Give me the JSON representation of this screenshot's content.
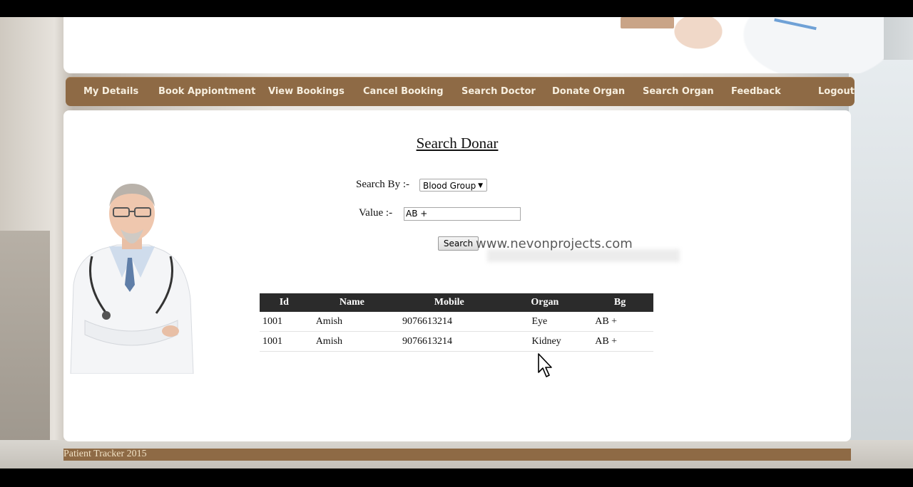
{
  "nav": {
    "items": [
      "My Details",
      "Book Appiontment",
      "View Bookings",
      "Cancel Booking",
      "Search Doctor",
      "Donate Organ",
      "Search Organ",
      "Feedback",
      "Logout"
    ]
  },
  "page": {
    "title": "Search Donar",
    "search_by_label": "Search By :-",
    "search_by_value": "Blood Group",
    "value_label": "Value :-",
    "value_input": "AB +",
    "search_button": "Search",
    "watermark": "www.nevonprojects.com"
  },
  "table": {
    "headers": [
      "Id",
      "Name",
      "Mobile",
      "Organ",
      "Bg"
    ],
    "rows": [
      [
        "1001",
        "Amish",
        "9076613214",
        "Eye",
        "AB +"
      ],
      [
        "1001",
        "Amish",
        "9076613214",
        "Kidney",
        "AB +"
      ]
    ]
  },
  "footer": {
    "text": "Patient Tracker 2015"
  },
  "colors": {
    "nav_bg": "#8e6a45",
    "nav_text": "#f7efdf",
    "table_header": "#2b2b2b"
  }
}
